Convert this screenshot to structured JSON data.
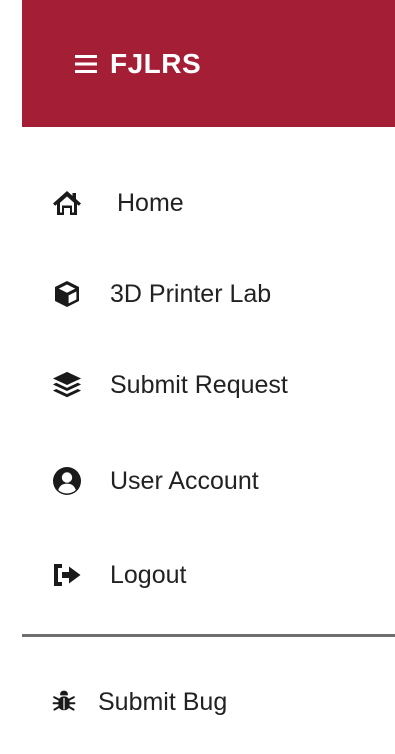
{
  "header": {
    "brand": "FJLRS",
    "background_color": "#a41e35",
    "menu_icon": "hamburger-icon"
  },
  "nav": {
    "items": [
      {
        "label": "Home",
        "icon": "home-icon"
      },
      {
        "label": "3D Printer Lab",
        "icon": "cube-icon"
      },
      {
        "label": "Submit Request",
        "icon": "layers-icon"
      },
      {
        "label": "User Account",
        "icon": "user-circle-icon"
      },
      {
        "label": "Logout",
        "icon": "logout-icon"
      }
    ],
    "secondary": [
      {
        "label": "Submit Bug",
        "icon": "bug-icon"
      }
    ]
  }
}
